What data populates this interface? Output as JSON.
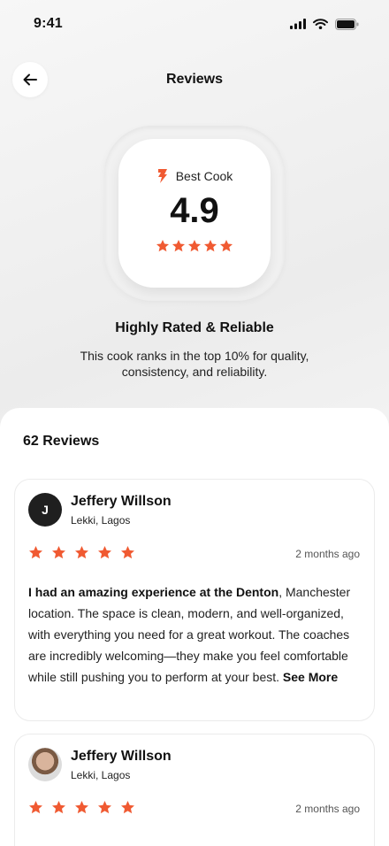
{
  "status_bar": {
    "time": "9:41"
  },
  "header": {
    "title": "Reviews"
  },
  "rating": {
    "badge": "Best Cook",
    "value": "4.9",
    "stars": 5
  },
  "headline": "Highly Rated & Reliable",
  "subtext": "This cook ranks in the top 10% for quality, consistency, and reliability.",
  "reviews": {
    "count_label": "62 Reviews",
    "items": [
      {
        "initial": "J",
        "name": "Jeffery Willson",
        "location": "Lekki, Lagos",
        "stars": 5,
        "ago": "2 months ago",
        "highlight": "I had an amazing experience at the Denton",
        "text": ", Manchester location. The space is clean, modern, and well-organized, with everything you need for a great workout. The coaches are incredibly welcoming—they make you feel comfortable while still pushing you to perform at your best. ",
        "see_more": "See More"
      },
      {
        "name": "Jeffery Willson",
        "location": "Lekki, Lagos",
        "stars": 5,
        "ago": "2 months ago"
      }
    ]
  },
  "colors": {
    "accent": "#F05A32",
    "dark": "#1F1F1F"
  },
  "icons": [
    "signal-icon",
    "wifi-icon",
    "battery-icon",
    "arrow-left-icon",
    "award-icon",
    "star-icon"
  ]
}
